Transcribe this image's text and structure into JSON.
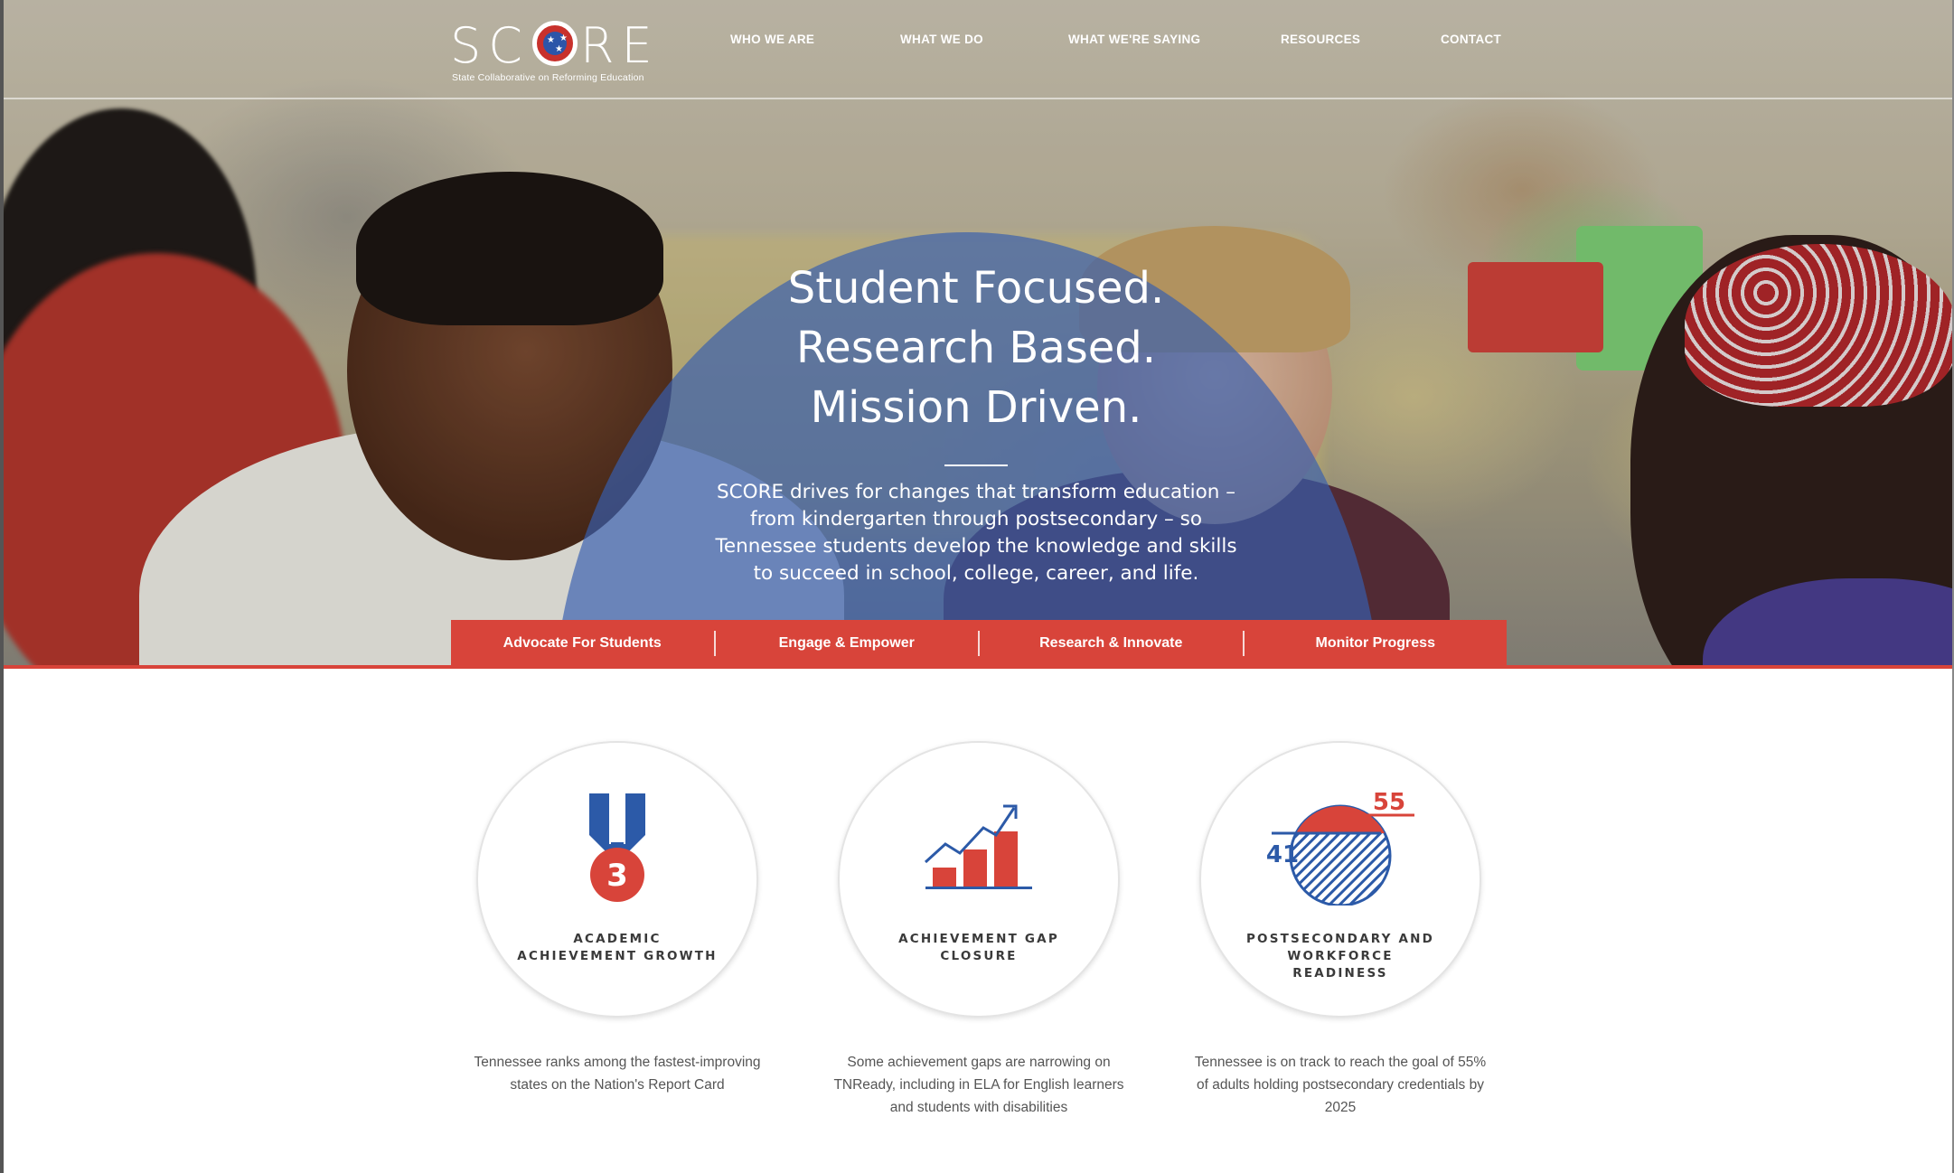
{
  "header": {
    "logo": {
      "wordmark": "SCORE",
      "tagline": "State Collaborative on Reforming Education"
    },
    "nav": [
      {
        "label": "WHO WE ARE"
      },
      {
        "label": "WHAT WE DO"
      },
      {
        "label": "WHAT WE'RE SAYING"
      },
      {
        "label": "RESOURCES"
      },
      {
        "label": "CONTACT"
      }
    ]
  },
  "hero": {
    "headline": [
      "Student Focused.",
      "Research Based.",
      "Mission Driven."
    ],
    "intro": "SCORE drives for changes that transform education – from kindergarten through postsecondary – so Tennessee students develop the knowledge and skills to succeed in school, college, career, and life."
  },
  "tabs": [
    {
      "label": "Advocate For Students"
    },
    {
      "label": "Engage & Empower"
    },
    {
      "label": "Research & Innovate"
    },
    {
      "label": "Monitor Progress"
    }
  ],
  "features": [
    {
      "icon": "medal-icon",
      "medal_number": "3",
      "title": "ACADEMIC ACHIEVEMENT GROWTH",
      "description": "Tennessee ranks among the fastest-improving states on the Nation's Report Card"
    },
    {
      "icon": "growth-chart-icon",
      "title": "ACHIEVEMENT GAP CLOSURE",
      "description": "Some achievement gaps are narrowing on TNReady, including in ELA for English learners and students with disabilities"
    },
    {
      "icon": "goal-circle-icon",
      "value_current": "41",
      "value_goal": "55",
      "title": "POSTSECONDARY AND WORKFORCE READINESS",
      "description": "Tennessee is on track to reach the goal of 55% of adults holding postsecondary credentials by 2025"
    }
  ],
  "colors": {
    "brand_red": "#d8443a",
    "brand_blue": "#2c5aa8",
    "overlay_blue": "#375faf"
  }
}
